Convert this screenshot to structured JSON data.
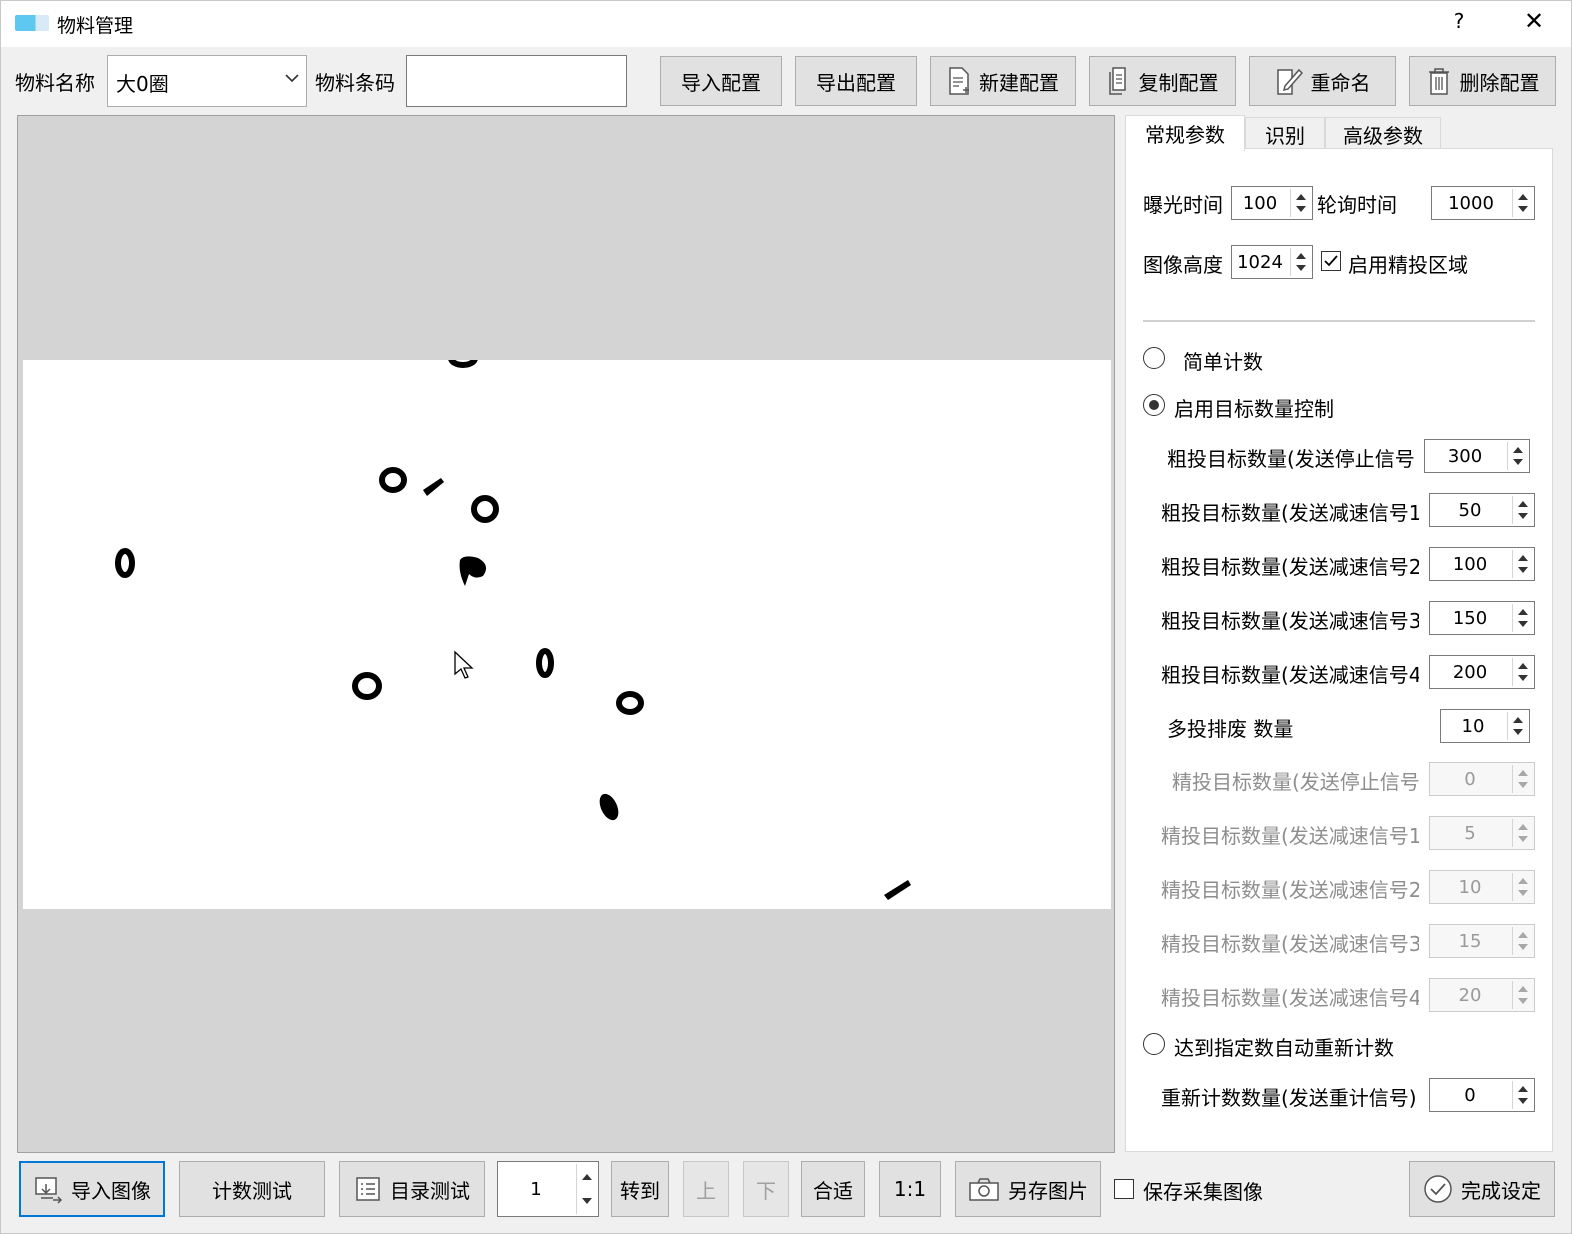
{
  "window": {
    "title": "物料管理",
    "help": "?",
    "close": "✕"
  },
  "toolbar": {
    "material_name_label": "物料名称",
    "material_name_value": "大0圈",
    "barcode_label": "物料条码",
    "barcode_value": "",
    "import_config": "导入配置",
    "export_config": "导出配置",
    "new_config": "新建配置",
    "copy_config": "复制配置",
    "rename": "重命名",
    "delete_config": "删除配置"
  },
  "tabs": [
    "常规参数",
    "识别",
    "高级参数"
  ],
  "params": {
    "exposure_label": "曝光时间",
    "exposure_value": "100",
    "poll_label": "轮询时间",
    "poll_value": "1000",
    "image_height_label": "图像高度",
    "image_height_value": "1024",
    "fine_region_label": "启用精投区域",
    "fine_region_checked": true,
    "simple_count_label": "简单计数",
    "target_ctrl_label": "启用目标数量控制",
    "coarse_rows": [
      {
        "label": "粗投目标数量(发送停止信号",
        "value": "300"
      },
      {
        "label": "粗投目标数量(发送减速信号1",
        "value": "50"
      },
      {
        "label": "粗投目标数量(发送减速信号2",
        "value": "100"
      },
      {
        "label": "粗投目标数量(发送减速信号3",
        "value": "150"
      },
      {
        "label": "粗投目标数量(发送减速信号4",
        "value": "200"
      }
    ],
    "multi_reject_label": "多投排废 数量",
    "multi_reject_value": "10",
    "fine_rows": [
      {
        "label": "精投目标数量(发送停止信号",
        "value": "0"
      },
      {
        "label": "精投目标数量(发送减速信号1",
        "value": "5"
      },
      {
        "label": "精投目标数量(发送减速信号2",
        "value": "10"
      },
      {
        "label": "精投目标数量(发送减速信号3",
        "value": "15"
      },
      {
        "label": "精投目标数量(发送减速信号4",
        "value": "20"
      }
    ],
    "auto_recount_label": "达到指定数自动重新计数",
    "recount_label": "重新计数数量(发送重计信号)",
    "recount_value": "0"
  },
  "bottom": {
    "import_image": "导入图像",
    "count_test": "计数测试",
    "dir_test": "目录测试",
    "page_value": "1",
    "goto": "转到",
    "prev": "上",
    "next": "下",
    "fit": "合适",
    "one_to_one": "1:1",
    "save_image": "另存图片",
    "save_capture_label": "保存采集图像",
    "finish": "完成设定"
  }
}
